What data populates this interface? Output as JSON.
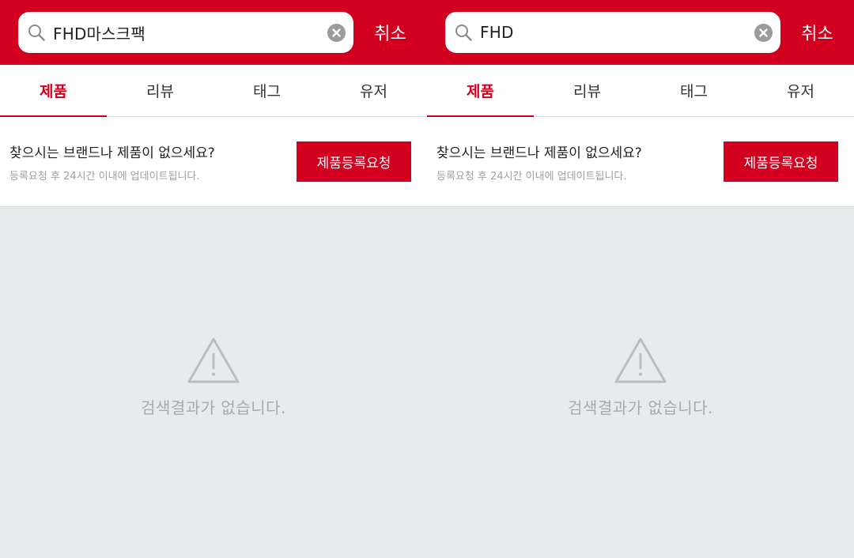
{
  "panels": [
    {
      "search": {
        "query": "FHD마스크팩",
        "cancel_label": "취소"
      },
      "tabs": [
        {
          "label": "제품",
          "active": true
        },
        {
          "label": "리뷰",
          "active": false
        },
        {
          "label": "태그",
          "active": false
        },
        {
          "label": "유저",
          "active": false
        }
      ],
      "request": {
        "title": "찾으시는 브랜드나 제품이 없으세요?",
        "subtitle": "등록요청 후 24시간 이내에 업데이트됩니다.",
        "button_label": "제품등록요청"
      },
      "empty": {
        "icon": "warning-icon",
        "message": "검색결과가 없습니다."
      }
    },
    {
      "search": {
        "query": "FHD",
        "cancel_label": "취소"
      },
      "tabs": [
        {
          "label": "제품",
          "active": true
        },
        {
          "label": "리뷰",
          "active": false
        },
        {
          "label": "태그",
          "active": false
        },
        {
          "label": "유저",
          "active": false
        }
      ],
      "request": {
        "title": "찾으시는 브랜드나 제품이 없으세요?",
        "subtitle": "등록요청 후 24시간 이내에 업데이트됩니다.",
        "button_label": "제품등록요청"
      },
      "empty": {
        "icon": "warning-icon",
        "message": "검색결과가 없습니다."
      }
    }
  ],
  "colors": {
    "brand": "#d2001e",
    "background": "#e8ebeb",
    "muted_text": "#a6aaaa"
  }
}
